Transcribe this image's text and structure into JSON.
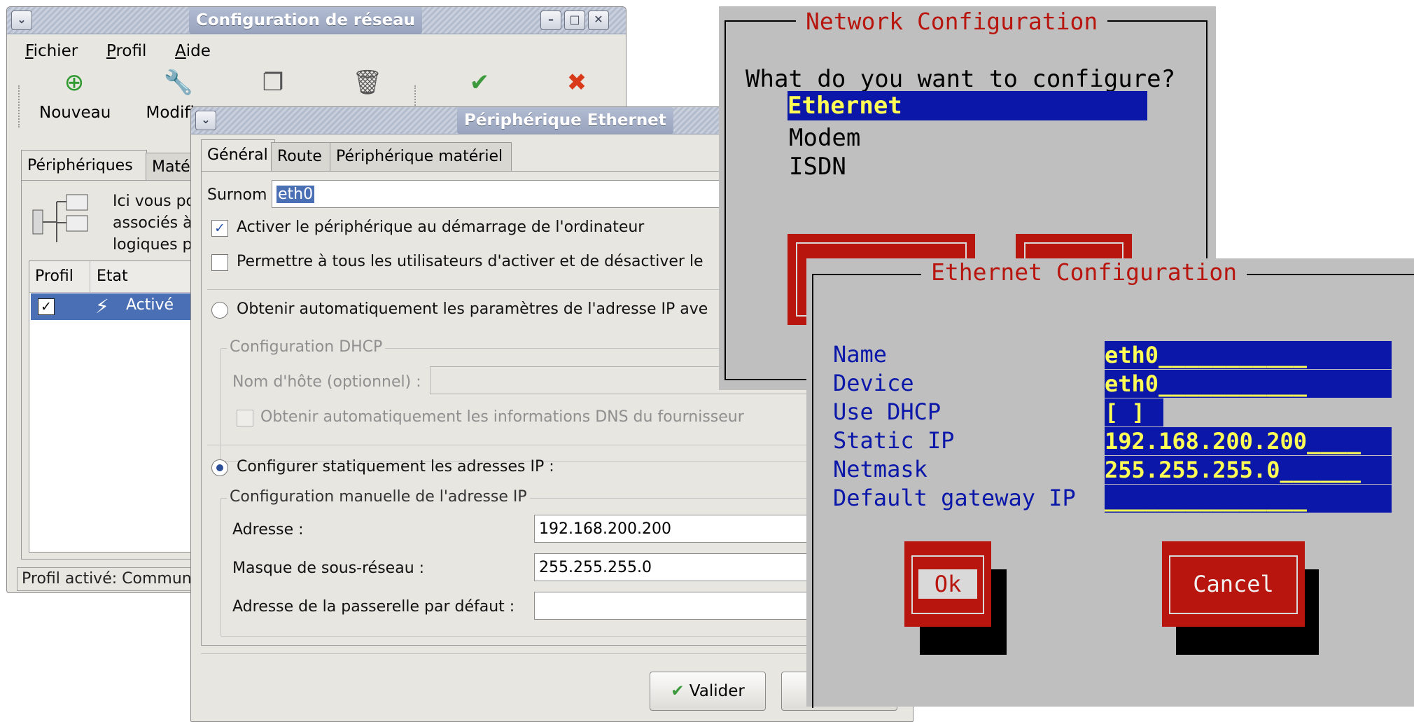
{
  "win1": {
    "title": "Configuration de réseau",
    "menu": [
      "Fichier",
      "Profil",
      "Aide"
    ],
    "toolbar": [
      "Nouveau",
      "Modifier"
    ],
    "tabs": [
      "Périphériques",
      "Matér"
    ],
    "desc_lines": [
      "Ici vous po",
      "associés à",
      "logiques pe"
    ],
    "columns": [
      "Profil",
      "Etat"
    ],
    "row": {
      "checked": "✓",
      "state": "Activé"
    },
    "status": "Profil activé: Commun"
  },
  "win2": {
    "title": "Périphérique Ethernet",
    "tabs": [
      "Général",
      "Route",
      "Périphérique matériel"
    ],
    "nickname_label": "Surnom",
    "nickname_value": "eth0",
    "chk_boot": "Activer le périphérique au démarrage de l'ordinateur",
    "chk_users": "Permettre à tous les utilisateurs d'activer et de désactiver le",
    "radio_auto": "Obtenir automatiquement les paramètres de l'adresse IP ave",
    "dhcp_frame": "Configuration DHCP",
    "hostname_label": "Nom d'hôte (optionnel) :",
    "chk_dns": "Obtenir automatiquement les informations DNS du fournisseur",
    "radio_static": "Configurer statiquement les adresses IP :",
    "manual_frame": "Configuration manuelle de l'adresse IP",
    "address_label": "Adresse :",
    "address_value": "192.168.200.200",
    "mask_label": "Masque de sous-réseau :",
    "mask_value": "255.255.255.0",
    "gateway_label": "Adresse de la passerelle par défaut :",
    "gateway_value": "",
    "ok_button": "Valider"
  },
  "tui1": {
    "title": "Network Configuration",
    "question": "What do you want to configure?",
    "options": [
      "Ethernet",
      "Modem",
      "ISDN"
    ]
  },
  "tui2": {
    "title": "Ethernet Configuration",
    "fields": [
      {
        "label": "Name",
        "value": "eth0___________"
      },
      {
        "label": "Device",
        "value": "eth0___________"
      },
      {
        "label": "Use DHCP",
        "value": "[ ]"
      },
      {
        "label": "Static IP",
        "value": "192.168.200.200____"
      },
      {
        "label": "Netmask",
        "value": "255.255.255.0______"
      },
      {
        "label": "Default gateway IP",
        "value": "_______________"
      }
    ],
    "ok": "Ok",
    "cancel": "Cancel"
  },
  "colors": {
    "tui_bg": "#bfbfbf",
    "tui_blue": "#0a17a8",
    "tui_red": "#b7150d",
    "tui_yellow": "#ffff55",
    "gtk_bg": "#e8e6e1",
    "selection": "#4a6fb5"
  }
}
